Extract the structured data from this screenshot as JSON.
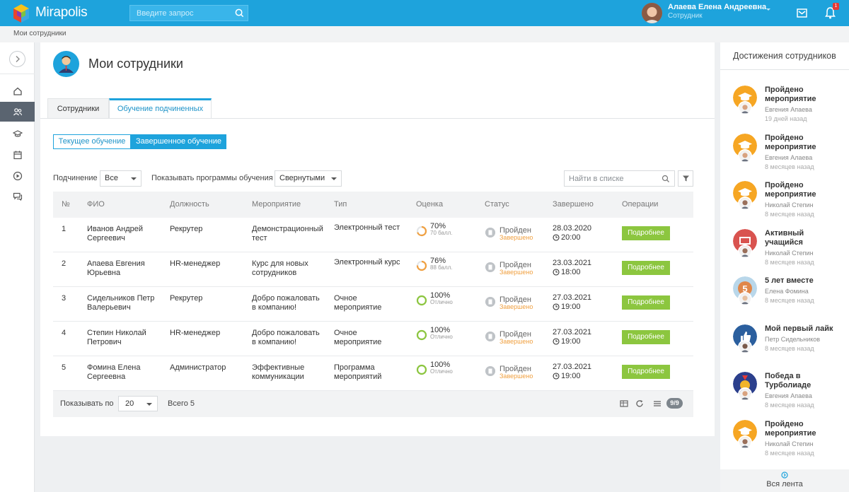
{
  "app": {
    "name": "Mirapolis"
  },
  "search": {
    "placeholder": "Введите запрос"
  },
  "user": {
    "name": "Алаева Елена Андреевна",
    "role": "Сотрудник"
  },
  "notifications": {
    "count": "1"
  },
  "breadcrumb": "Мои сотрудники",
  "page": {
    "title": "Мои сотрудники"
  },
  "tabs": [
    {
      "label": "Сотрудники"
    },
    {
      "label": "Обучение подчиненных"
    }
  ],
  "segments": [
    {
      "label": "Текущее обучение"
    },
    {
      "label": "Завершенное обучение"
    }
  ],
  "filters": {
    "subordination_label": "Подчинение",
    "subordination_value": "Все",
    "programs_label": "Показывать программы обучения",
    "programs_value": "Свернутыми",
    "search_placeholder": "Найти в списке"
  },
  "table": {
    "columns": [
      "№",
      "ФИО",
      "Должность",
      "Мероприятие",
      "Тип",
      "Оценка",
      "Статус",
      "Завершено",
      "Операции"
    ],
    "rows": [
      {
        "num": "1",
        "name1": "Иванов Андрей",
        "name2": "Сергеевич",
        "position": "Рекрутер",
        "event1": "Демонстрационный",
        "event2": "тест",
        "type1": "Электронный тест",
        "type2": "",
        "score": "70%",
        "score_pct": 70,
        "score_sub": "70 балл.",
        "status": "Пройден",
        "status_sub": "Завершено",
        "date": "28.03.2020",
        "time": "20:00",
        "action": "Подробнее"
      },
      {
        "num": "2",
        "name1": "Апаева Евгения",
        "name2": "Юрьевна",
        "position": "HR-менеджер",
        "event1": "Курс для новых",
        "event2": "сотрудников",
        "type1": "Электронный курс",
        "type2": "",
        "score": "76%",
        "score_pct": 76,
        "score_sub": "88 балл.",
        "status": "Пройден",
        "status_sub": "Завершено",
        "date": "23.03.2021",
        "time": "18:00",
        "action": "Подробнее"
      },
      {
        "num": "3",
        "name1": "Сидельников Петр",
        "name2": "Валерьевич",
        "position": "Рекрутер",
        "event1": "Добро пожаловать",
        "event2": "в компанию!",
        "type1": "Очное",
        "type2": "мероприятие",
        "score": "100%",
        "score_pct": 100,
        "score_sub": "Отлично",
        "status": "Пройден",
        "status_sub": "Завершено",
        "date": "27.03.2021",
        "time": "19:00",
        "action": "Подробнее"
      },
      {
        "num": "4",
        "name1": "Степин Николай",
        "name2": "Петрович",
        "position": "HR-менеджер",
        "event1": "Добро пожаловать",
        "event2": "в компанию!",
        "type1": "Очное",
        "type2": "мероприятие",
        "score": "100%",
        "score_pct": 100,
        "score_sub": "Отлично",
        "status": "Пройден",
        "status_sub": "Завершено",
        "date": "27.03.2021",
        "time": "19:00",
        "action": "Подробнее"
      },
      {
        "num": "5",
        "name1": "Фомина Елена",
        "name2": "Сергеевна",
        "position": "Администратор",
        "event1": "Эффективные",
        "event2": "коммуникации",
        "type1": "Программа",
        "type2": "мероприятий",
        "score": "100%",
        "score_pct": 100,
        "score_sub": "Отлично",
        "status": "Пройден",
        "status_sub": "Завершено",
        "date": "27.03.2021",
        "time": "19:00",
        "action": "Подробнее"
      }
    ]
  },
  "footer": {
    "page_size_label": "Показывать по",
    "page_size": "20",
    "total": "Всего 5",
    "columns_badge": "9/9"
  },
  "achievements": {
    "title": "Достижения сотрудников",
    "items": [
      {
        "title": "Пройдено мероприятие",
        "user": "Евгения Апаева",
        "time": "19 дней назад",
        "color": "#f6a623",
        "face": "#d8a27f"
      },
      {
        "title": "Пройдено мероприятие",
        "user": "Евгения Алаева",
        "time": "8 месяцев назад",
        "color": "#f6a623",
        "face": "#d8a27f"
      },
      {
        "title": "Пройдено мероприятие",
        "user": "Николай Степин",
        "time": "8 месяцев назад",
        "color": "#f6a623",
        "face": "#9a6f5a"
      },
      {
        "title": "Активный учащийся",
        "user": "Николай Степин",
        "time": "8 месяцев назад",
        "color": "#d9534f",
        "face": "#9a6f5a"
      },
      {
        "title": "5 лет вместе",
        "user": "Елена Фомина",
        "time": "8 месяцев назад",
        "color": "#b9d7ea",
        "face": "#e6c0a0"
      },
      {
        "title": "Мой первый лайк",
        "user": "Петр Сидельников",
        "time": "8 месяцев назад",
        "color": "#2b5f9e",
        "face": "#7a5a4a"
      },
      {
        "title": "Победа в Турболиаде",
        "user": "Евгения Апаева",
        "time": "8 месяцев назад",
        "color": "#2b3f8c",
        "face": "#d8a27f"
      },
      {
        "title": "Пройдено мероприятие",
        "user": "Николай Степин",
        "time": "8 месяцев назад",
        "color": "#f6a623",
        "face": "#9a6f5a"
      }
    ],
    "feed_link": "Вся лента"
  },
  "colors": {
    "accent": "#1ea3dc",
    "success": "#8cc63f",
    "warning": "#f0a040"
  }
}
